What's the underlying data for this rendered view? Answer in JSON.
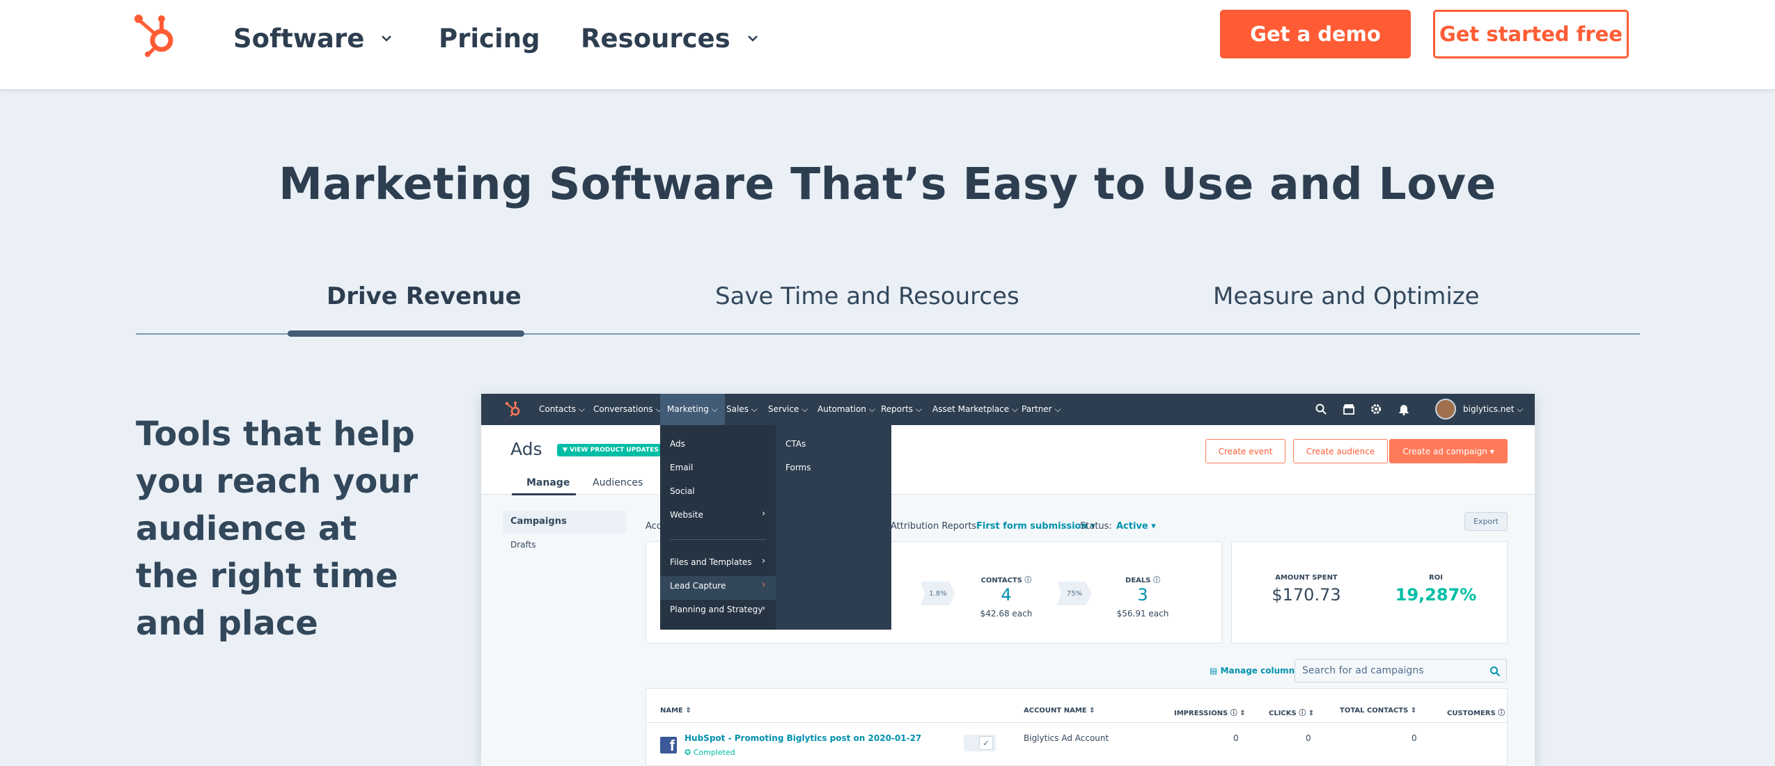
{
  "nav": {
    "items": [
      "Software",
      "Pricing",
      "Resources"
    ],
    "demo_button": "Get a demo",
    "free_button": "Get started free"
  },
  "hero": {
    "headline": "Marketing Software That’s Easy to Use and Love",
    "tabs": [
      "Drive Revenue",
      "Save Time and Resources",
      "Measure and Optimize"
    ],
    "active_tab": "Drive Revenue",
    "copy_lines": [
      "Tools that help",
      "you reach your",
      "audience at",
      "the right time",
      "and place"
    ]
  },
  "app": {
    "tabs": [
      "Contacts",
      "Conversations",
      "Marketing",
      "Sales",
      "Service",
      "Automation",
      "Reports",
      "Asset Marketplace",
      "Partner"
    ],
    "account": "biglytics.net",
    "title": "Ads",
    "badge": "VIEW PRODUCT UPDATES",
    "subtabs": [
      "Manage",
      "Audiences"
    ],
    "buttons": {
      "event": "Create event",
      "audience": "Create audience",
      "campaign": "Create ad campaign"
    },
    "sidebar": [
      "Campaigns",
      "Drafts"
    ],
    "filters": {
      "account_prefix": "Acc",
      "attribution_label": "Attribution Reports:",
      "attribution_value": "First form submission",
      "status_label": "Status:",
      "status_value": "Active",
      "export": "Export"
    },
    "funnel": {
      "rate1": "1.8%",
      "contacts_label": "CONTACTS",
      "contacts_value": "4",
      "contacts_each": "$42.68 each",
      "rate2": "75%",
      "deals_label": "DEALS",
      "deals_value": "3",
      "deals_each": "$56.91 each"
    },
    "summary": {
      "spent_label": "AMOUNT SPENT",
      "spent_value": "$170.73",
      "roi_label": "ROI",
      "roi_value": "19,287%"
    },
    "manage_columns": "Manage columns",
    "search_placeholder": "Search for ad campaigns",
    "table": {
      "headers": [
        "NAME",
        "ACCOUNT NAME",
        "IMPRESSIONS",
        "CLICKS",
        "TOTAL CONTACTS",
        "CUSTOMERS"
      ],
      "row": {
        "name": "HubSpot - Promoting Biglytics post on 2020-01-27",
        "status": "Completed",
        "account": "Biglytics Ad Account",
        "impressions": "0",
        "clicks": "0",
        "contacts": "0"
      }
    },
    "menu": {
      "primary": [
        "Ads",
        "Email",
        "Social",
        "Website",
        "Files and Templates",
        "Lead Capture",
        "Planning and Strategy"
      ],
      "secondary": [
        "CTAs",
        "Forms"
      ]
    }
  },
  "colors": {
    "brand_orange": "#ff5c35",
    "navy": "#2d3e50",
    "teal": "#00bda5",
    "link": "#0091ae",
    "bg": "#eaf0f6"
  }
}
